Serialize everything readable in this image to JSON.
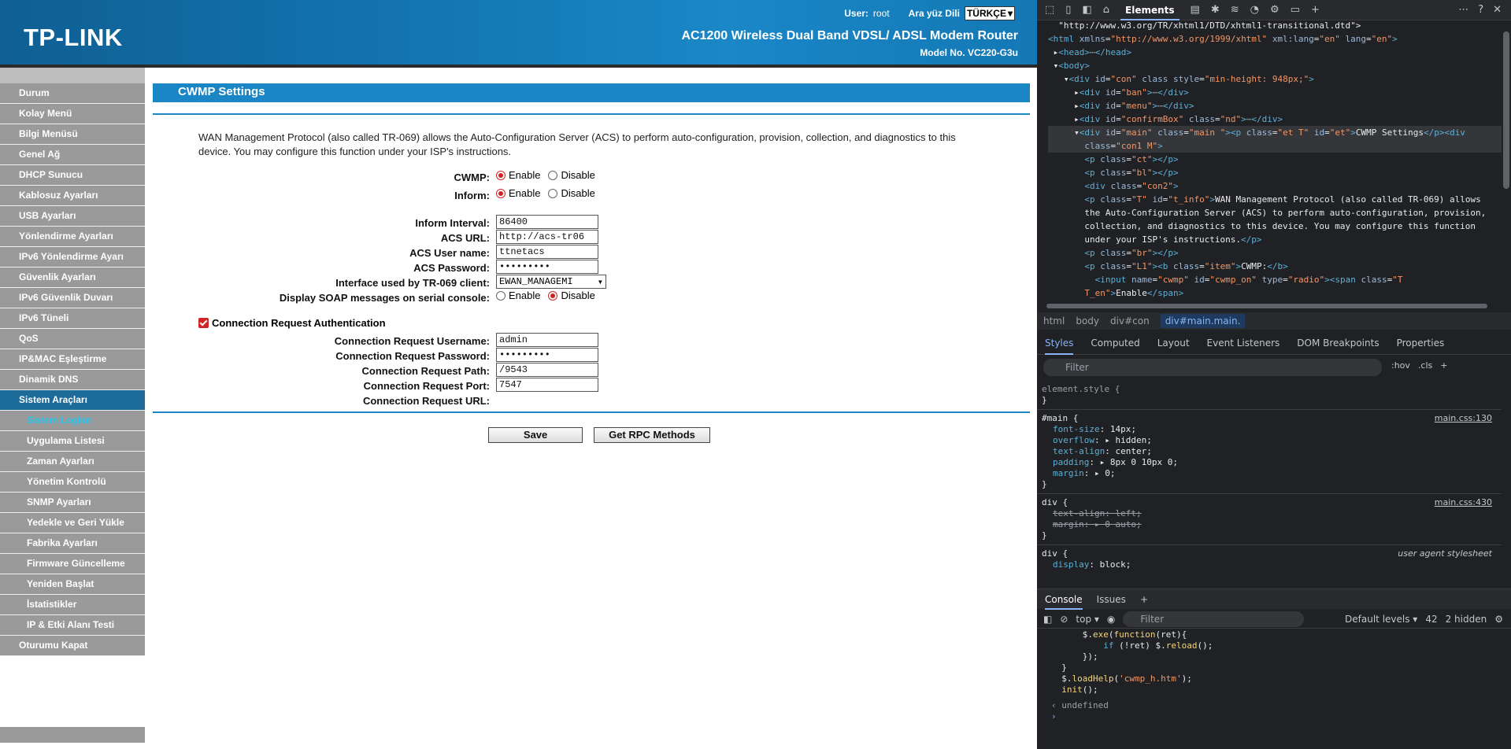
{
  "router": {
    "logo": "TP-LINK",
    "user_label": "User:",
    "user_value": "root",
    "lang_label": "Ara yüz Dili",
    "lang_value": "TÜRKÇE",
    "product": "AC1200 Wireless Dual Band VDSL/ ADSL Modem Router",
    "model": "Model No. VC220-G3u",
    "menu": [
      {
        "label": "Durum",
        "sub": false
      },
      {
        "label": "Kolay Menü",
        "sub": false
      },
      {
        "label": "Bilgi Menüsü",
        "sub": false
      },
      {
        "label": "Genel Ağ",
        "sub": false
      },
      {
        "label": "DHCP Sunucu",
        "sub": false
      },
      {
        "label": "Kablosuz Ayarları",
        "sub": false
      },
      {
        "label": "USB Ayarları",
        "sub": false
      },
      {
        "label": "Yönlendirme Ayarları",
        "sub": false
      },
      {
        "label": "IPv6 Yönlendirme Ayarı",
        "sub": false
      },
      {
        "label": "Güvenlik Ayarları",
        "sub": false
      },
      {
        "label": "IPv6 Güvenlik Duvarı",
        "sub": false
      },
      {
        "label": "IPv6 Tüneli",
        "sub": false
      },
      {
        "label": "QoS",
        "sub": false
      },
      {
        "label": "IP&MAC Eşleştirme",
        "sub": false
      },
      {
        "label": "Dinamik DNS",
        "sub": false
      },
      {
        "label": "Sistem Araçları",
        "sub": false,
        "active": true
      },
      {
        "label": "Sistem Logları",
        "sub": true,
        "current": true
      },
      {
        "label": "Uygulama Listesi",
        "sub": true
      },
      {
        "label": "Zaman Ayarları",
        "sub": true
      },
      {
        "label": "Yönetim Kontrolü",
        "sub": true
      },
      {
        "label": "SNMP Ayarları",
        "sub": true
      },
      {
        "label": "Yedekle ve Geri Yükle",
        "sub": true
      },
      {
        "label": "Fabrika Ayarları",
        "sub": true
      },
      {
        "label": "Firmware Güncelleme",
        "sub": true
      },
      {
        "label": "Yeniden Başlat",
        "sub": true
      },
      {
        "label": "İstatistikler",
        "sub": true
      },
      {
        "label": "IP & Etki Alanı Testi",
        "sub": true
      },
      {
        "label": "Oturumu Kapat",
        "sub": false
      }
    ],
    "page_title": "CWMP Settings",
    "intro": "WAN Management Protocol (also called TR-069) allows the Auto-Configuration Server (ACS) to perform auto-configuration, provision, collection, and diagnostics to this device. You may configure this function under your ISP's instructions.",
    "enable_label": "Enable",
    "disable_label": "Disable",
    "cwmp_label": "CWMP:",
    "inform_label": "Inform:",
    "inform_interval_label": "Inform Interval:",
    "inform_interval_value": "86400",
    "acs_url_label": "ACS URL:",
    "acs_url_value": "http://acs-tr06",
    "acs_user_label": "ACS User name:",
    "acs_user_value": "ttnetacs",
    "acs_pass_label": "ACS Password:",
    "acs_pass_value": "•••••••••",
    "iface_label": "Interface used by TR-069 client:",
    "iface_value": "EWAN_MANAGEMI",
    "soap_label": "Display SOAP messages on serial console:",
    "conn_auth_label": "Connection Request Authentication",
    "cr_user_label": "Connection Request Username:",
    "cr_user_value": "admin",
    "cr_pass_label": "Connection Request Password:",
    "cr_pass_value": "•••••••••",
    "cr_path_label": "Connection Request Path:",
    "cr_path_value": "/9543",
    "cr_port_label": "Connection Request Port:",
    "cr_port_value": "7547",
    "cr_url_label": "Connection Request URL:",
    "save_label": "Save",
    "rpc_label": "Get RPC Methods",
    "accent": "#1a86c5"
  },
  "devtools": {
    "elements_tab": "Elements",
    "crumbs": [
      "html",
      "body",
      "div#con",
      "div#main.main."
    ],
    "style_tabs": [
      "Styles",
      "Computed",
      "Layout",
      "Event Listeners",
      "DOM Breakpoints",
      "Properties"
    ],
    "filter_placeholder": "Filter",
    "hov": ":hov",
    "cls": ".cls",
    "console_tabs": [
      "Console",
      "Issues"
    ],
    "console_top": "top",
    "console_filter": "Filter",
    "default_levels": "Default levels",
    "issues_count": "42",
    "hidden": "2 hidden",
    "main_css_130": "main.css:130",
    "main_css_430": "main.css:430",
    "ua_stylesheet": "user agent stylesheet",
    "undefined": "undefined"
  }
}
